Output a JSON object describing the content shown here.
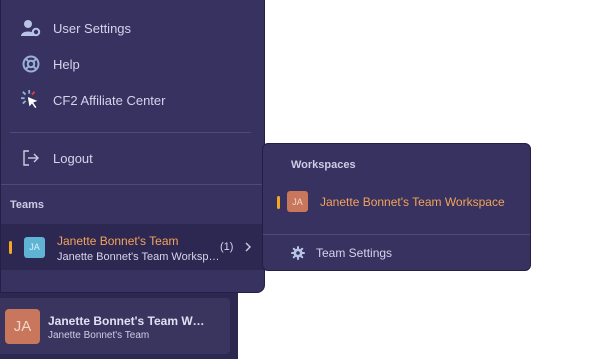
{
  "menu": {
    "items": [
      {
        "label": "User Settings",
        "icon": "user-gear-icon"
      },
      {
        "label": "Help",
        "icon": "lifebuoy-icon"
      },
      {
        "label": "CF2 Affiliate Center",
        "icon": "cursor-click-icon"
      },
      {
        "label": "Logout",
        "icon": "logout-icon"
      }
    ],
    "teams_heading": "Teams",
    "team": {
      "initials": "JA",
      "name": "Janette Bonnet's Team",
      "workspace": "Janette Bonnet's Team Workspace",
      "count": "(1)"
    }
  },
  "popover": {
    "title": "Workspaces",
    "workspace": {
      "initials": "JA",
      "name": "Janette Bonnet's Team Workspace"
    },
    "settings_label": "Team Settings"
  },
  "current": {
    "initials": "JA",
    "name": "Janette Bonnet's Team Workspace",
    "team": "Janette Bonnet's Team"
  },
  "colors": {
    "accent": "#f5a623",
    "active_text": "#f5a25a",
    "panel": "#37325f",
    "sidebar": "#2c2852"
  }
}
